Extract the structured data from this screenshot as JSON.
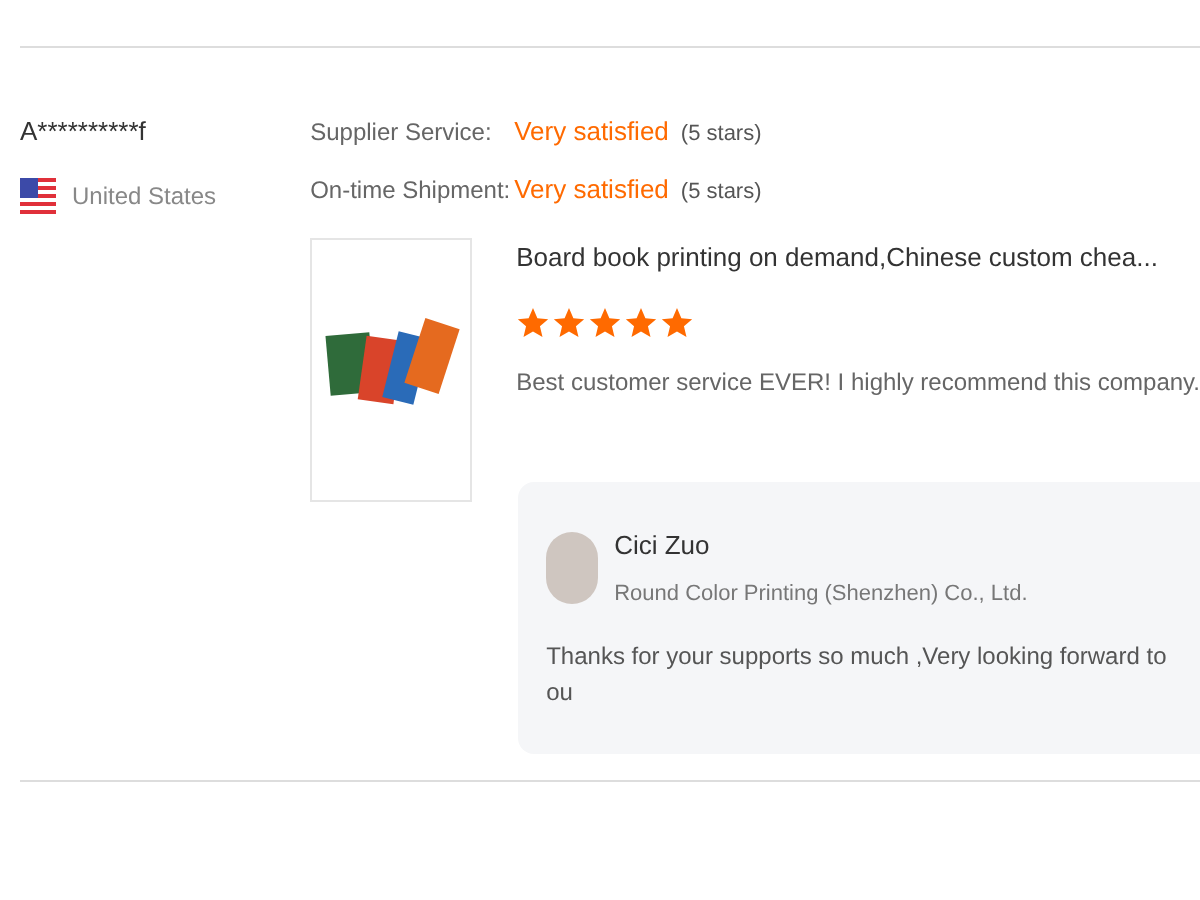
{
  "reviewer": {
    "name": "A**********f",
    "country": "United States"
  },
  "ratings": [
    {
      "label": "Supplier Service:",
      "value": "Very satisfied",
      "stars_text": "(5 stars)"
    },
    {
      "label": "On-time Shipment:",
      "value": "Very satisfied",
      "stars_text": "(5 stars)"
    }
  ],
  "product": {
    "title": "Board book printing on demand,Chinese custom chea...",
    "stars": 5,
    "comment": "Best customer service EVER! I highly recommend this company."
  },
  "reply": {
    "name": "Cici Zuo",
    "company": "Round Color Printing (Shenzhen) Co., Ltd.",
    "text": "Thanks for your supports so much ,Very looking forward to ou"
  }
}
